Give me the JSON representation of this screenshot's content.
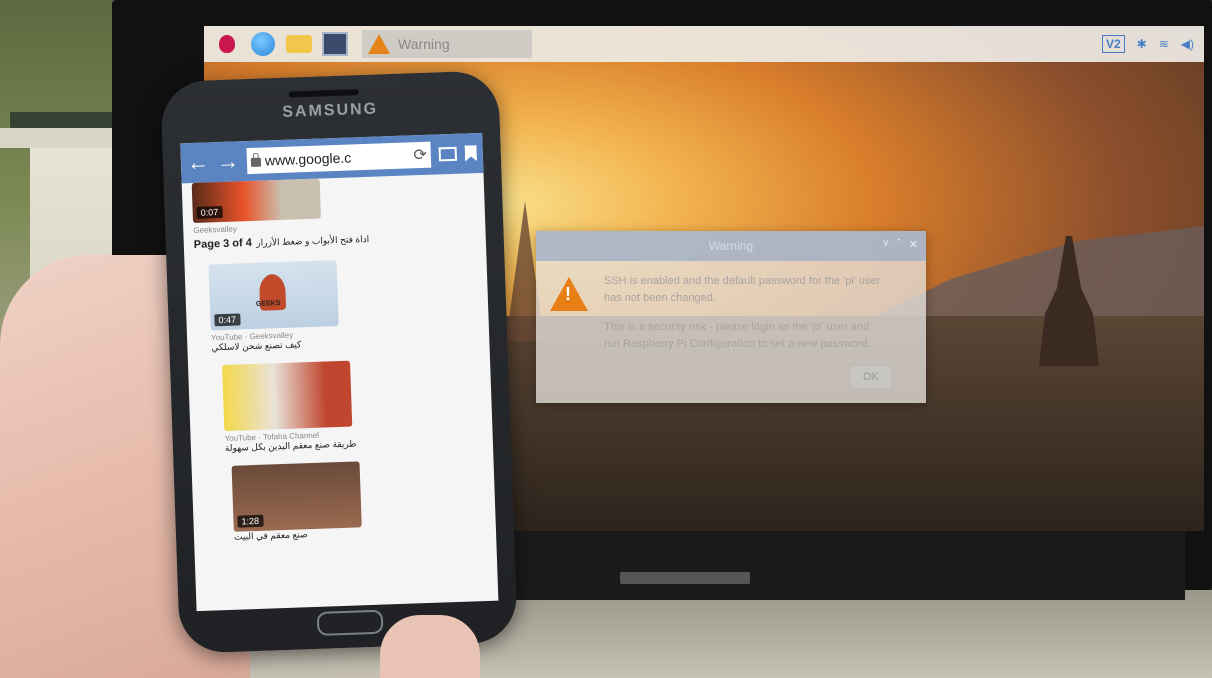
{
  "raspberry_desktop": {
    "taskbar": {
      "task_title": "Warning",
      "vnc_label": "V2"
    },
    "dialog": {
      "title": "Warning",
      "message_line1": "SSH is enabled and the default password for the 'pi' user",
      "message_line2": "has not been changed.",
      "message_line3": "This is a security risk - please login as the 'pi' user and",
      "message_line4": "run Raspberry Pi Configuration to set a new password.",
      "ok_label": "OK",
      "controls": [
        "˅",
        "ˆ",
        "✕"
      ]
    }
  },
  "phone": {
    "brand": "SAMSUNG",
    "browser": {
      "url": "www.google.c",
      "back_icon": "←",
      "forward_icon": "→",
      "reload_icon": "⟳"
    },
    "videos": [
      {
        "duration": "0:07",
        "channel": "Geeksvalley",
        "page": "Page 3 of 4",
        "title": "اداة فتح الأبواب و ضغط الأزرار"
      },
      {
        "duration": "0:47",
        "source": "YouTube",
        "channel": "Geeksvalley",
        "title": "كيف تصنع شحن لاسلكي",
        "logo": "GEEKS"
      },
      {
        "duration": "",
        "source": "YouTube",
        "channel": "Tofaha Channel",
        "title": "طريقة صنع معقم اليدين بكل سهولة"
      },
      {
        "duration": "1:28",
        "source": "",
        "channel": "",
        "title": "صنع معقم في البيت"
      }
    ]
  }
}
